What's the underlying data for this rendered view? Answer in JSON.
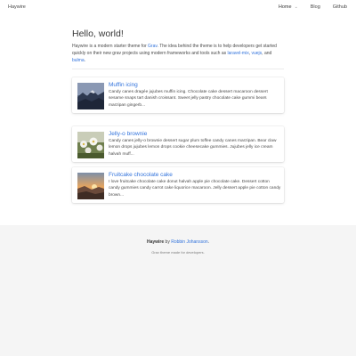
{
  "navbar": {
    "brand": "Haywire",
    "items": [
      {
        "label": "Home",
        "active": true,
        "dropdown": true
      },
      {
        "label": "Blog",
        "active": false,
        "dropdown": false
      },
      {
        "label": "Github",
        "active": false,
        "dropdown": false
      }
    ]
  },
  "hero": {
    "title": "Hello, world!",
    "intro_part1": "Haywire is a modern starter theme for ",
    "intro_link_grav": "Grav",
    "intro_part2": ". The idea behind the theme is to help developers get started quickly on their new grav projects using modern frameworks and tools such as ",
    "intro_link_laravel": "laravel-mix",
    "intro_sep1": ", ",
    "intro_link_vuejs": "vuejs",
    "intro_part3": ", and ",
    "intro_link_bulma": "bulma",
    "intro_end": "."
  },
  "posts": [
    {
      "title": "Muffin icing",
      "excerpt": "Candy canes dragée jujubes muffin icing. Chocolate cake dessert macaroon dessert sesame snaps tart danish croissant. Sweet jelly pastry chocolate cake gummi bears marzipan gingerb...",
      "image_icon": "mountain-photo-icon"
    },
    {
      "title": "Jelly-o brownie",
      "excerpt": "Candy canes jelly-o brownie dessert sugar plum toffee candy canes marzipan. Bear claw lemon drops jujubes lemon drops cookie cheesecake gummies. Jujubes jelly ice cream halvah muff...",
      "image_icon": "flowers-photo-icon"
    },
    {
      "title": "Fruitcake chocolate cake",
      "excerpt": "I love fruitcake chocolate cake donut halvah apple pie chocolate cake. Dessert cotton candy gummies candy carrot cake liquorice macaroon. Jelly dessert apple pie cotton candy brown...",
      "image_icon": "sunset-photo-icon"
    }
  ],
  "footer": {
    "brand": "Haywire",
    "by": " by ",
    "author": "Robbin Johansson",
    "period": ".",
    "tagline": "Grav theme made for developers."
  },
  "colors": {
    "link": "#3273dc",
    "text": "#4a4a4a",
    "footer_bg": "#f5f5f5"
  }
}
